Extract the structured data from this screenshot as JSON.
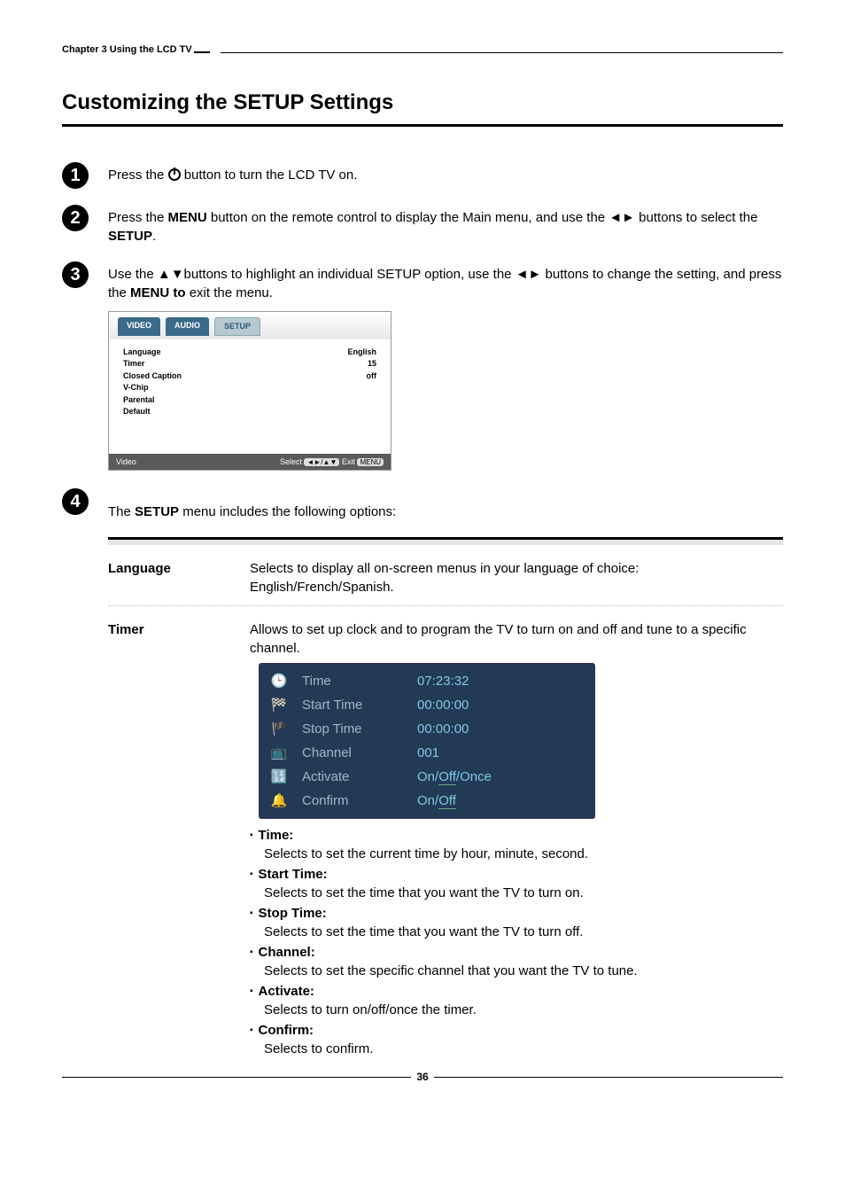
{
  "header": {
    "chapter_label": "Chapter 3 Using the LCD TV"
  },
  "title": "Customizing the SETUP Settings",
  "steps": {
    "s1_a": "Press the ",
    "s1_b": " button to turn the LCD TV on.",
    "s2_a": "Press the ",
    "s2_menu": "MENU",
    "s2_b": " button on the remote control to display the Main menu, and use the ◄► buttons to select the ",
    "s2_setup": "SETUP",
    "s2_c": ".",
    "s3_a": "Use the ▲▼buttons to highlight an individual SETUP option, use the ◄► buttons to change the setting, and press the ",
    "s3_menu": "MENU to",
    "s3_b": " exit the menu.",
    "s4_a": "The ",
    "s4_setup": "SETUP",
    "s4_b": " menu includes the following options:"
  },
  "panel": {
    "tabs": {
      "video": "VIDEO",
      "audio": "AUDIO",
      "setup": "SETUP"
    },
    "rows": [
      {
        "label": "Language",
        "value": "English"
      },
      {
        "label": "Timer",
        "value": "15"
      },
      {
        "label": "Closed Caption",
        "value": "off"
      },
      {
        "label": "V-Chip",
        "value": ""
      },
      {
        "label": "Parental",
        "value": ""
      },
      {
        "label": "Default",
        "value": ""
      }
    ],
    "footer_left": "Video",
    "footer_select": "Select",
    "footer_nav": "◄►/▲▼",
    "footer_exit": "Exit",
    "footer_menu": "MENU"
  },
  "options": {
    "language": {
      "name": "Language",
      "desc": "Selects to display all on-screen menus in your language of choice: English/French/Spanish."
    },
    "timer": {
      "name": "Timer",
      "desc": "Allows to set up clock and to program the TV to turn on and off and tune to a specific channel.",
      "menu": [
        {
          "label": "Time",
          "value": "07:23:32"
        },
        {
          "label": "Start Time",
          "value": "00:00:00"
        },
        {
          "label": "Stop Time",
          "value": "00:00:00"
        },
        {
          "label": "Channel",
          "value": "001"
        },
        {
          "label": "Activate",
          "value_a": "On/",
          "value_b": "Off",
          "value_c": "/Once"
        },
        {
          "label": "Confirm",
          "value_a": "On/",
          "value_b": "Off",
          "value_c": ""
        }
      ],
      "sub": [
        {
          "title": "Time:",
          "desc": "Selects to set the current time by hour, minute, second."
        },
        {
          "title": "Start Time:",
          "desc": "Selects to set the time that you want the TV to turn on."
        },
        {
          "title": "Stop Time:",
          "desc": "Selects to set the time that you want the TV to turn off."
        },
        {
          "title": "Channel:",
          "desc": "Selects to set the specific channel that you want the TV to tune."
        },
        {
          "title": "Activate:",
          "desc": "Selects to turn on/off/once the timer."
        },
        {
          "title": "Confirm:",
          "desc": "Selects to confirm."
        }
      ]
    }
  },
  "page_number": "36"
}
